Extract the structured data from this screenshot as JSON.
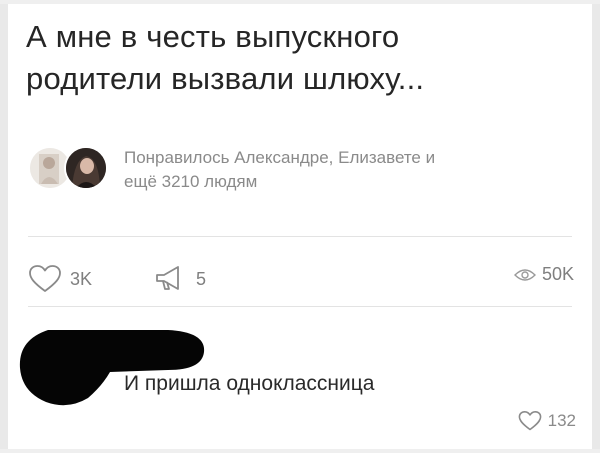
{
  "post": {
    "text_lines": [
      "А мне в честь выпускного",
      "родители вызвали шлюху..."
    ]
  },
  "likers": {
    "line1": "Понравилось Александре, Елизавете и",
    "line2": "ещё 3210 людям"
  },
  "actions": {
    "likes": "3K",
    "reposts": "5",
    "views": "50K"
  },
  "comment": {
    "text": "И пришла одноклассница",
    "likes": "132"
  },
  "icons": {
    "like": "heart-icon",
    "repost": "megaphone-icon",
    "views": "eye-icon",
    "comment_like": "heart-icon"
  },
  "colors": {
    "text": "#262626",
    "muted": "#8a8a8a",
    "divider": "#e3e3e3"
  }
}
